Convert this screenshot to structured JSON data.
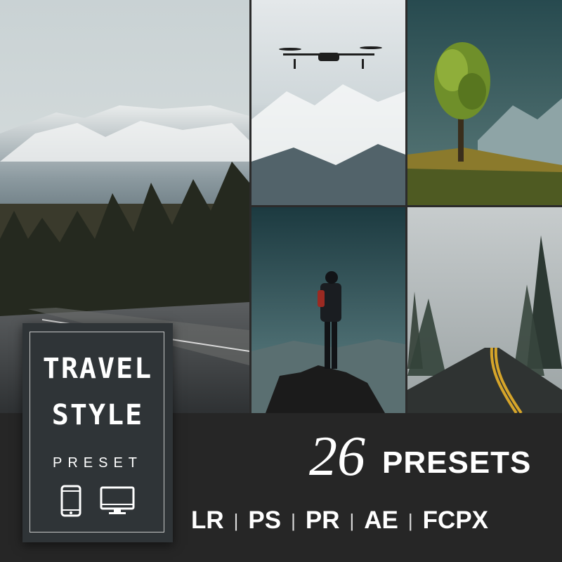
{
  "badge": {
    "title_line1": "TRAVEL",
    "title_line2": "STYLE",
    "subtitle": "PRESET",
    "icons": [
      "phone-icon",
      "monitor-icon"
    ]
  },
  "promo": {
    "count": "26",
    "count_label": "PRESETS"
  },
  "apps": [
    "LR",
    "PS",
    "PR",
    "AE",
    "FCPX"
  ],
  "separator": "|",
  "colors": {
    "band": "#262626",
    "badge_bg": "#2f3437",
    "text": "#ffffff"
  }
}
